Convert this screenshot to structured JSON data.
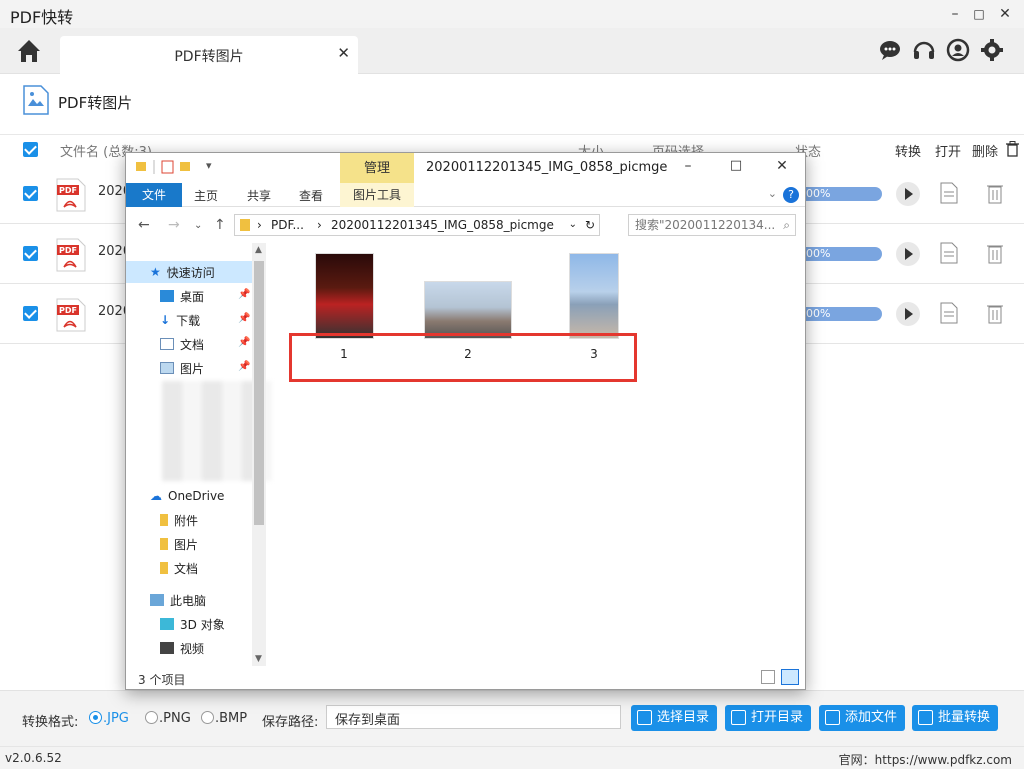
{
  "app": {
    "title": "PDF快转",
    "version": "v2.0.6.52",
    "site": "官网：https://www.pdfkz.com"
  },
  "window_controls": {
    "minimize": "–",
    "maximize": "□",
    "close": "✕"
  },
  "tab": {
    "label": "PDF转图片",
    "close": "✕"
  },
  "section": {
    "title": "PDF转图片"
  },
  "table": {
    "headers": {
      "filename": "文件名 (总数:3)",
      "size": "大小",
      "pages": "页码选择",
      "status": "状态",
      "convert": "转换",
      "open": "打开",
      "delete": "删除"
    },
    "rows": [
      {
        "name": "2020",
        "progress": "00%"
      },
      {
        "name": "2020",
        "progress": "00%"
      },
      {
        "name": "2020",
        "progress": "00%"
      }
    ]
  },
  "bottom": {
    "format_label": "转换格式:",
    "formats": [
      ".JPG",
      ".PNG",
      ".BMP"
    ],
    "selected_format": ".JPG",
    "path_label": "保存路径:",
    "path_value": "保存到桌面",
    "buttons": {
      "choose_dir": "选择目录",
      "open_dir": "打开目录",
      "add_file": "添加文件",
      "batch_convert": "批量转换"
    }
  },
  "explorer": {
    "quick_access_glyph": "▾",
    "manage_tab": "管理",
    "title": "20200112201345_IMG_0858_picmge",
    "ribbon": {
      "file": "文件",
      "home": "主页",
      "share": "共享",
      "view": "查看",
      "picture_tools": "图片工具"
    },
    "address": {
      "crumb1": "PDF...",
      "crumb2": "20200112201345_IMG_0858_picmge",
      "search_placeholder": "搜索\"2020011220134..."
    },
    "nav": {
      "quick_access": "快速访问",
      "desktop": "桌面",
      "downloads": "下载",
      "documents": "文档",
      "pictures": "图片",
      "onedrive": "OneDrive",
      "attachments": "附件",
      "od_pictures": "图片",
      "od_documents": "文档",
      "this_pc": "此电脑",
      "objects_3d": "3D 对象",
      "videos": "视频"
    },
    "items": [
      {
        "label": "1"
      },
      {
        "label": "2"
      },
      {
        "label": "3"
      }
    ],
    "status_count": "3 个项目"
  },
  "colors": {
    "accent": "#1a90e8",
    "highlight_box": "#e4372f",
    "manage_tab": "#f5e28a"
  }
}
